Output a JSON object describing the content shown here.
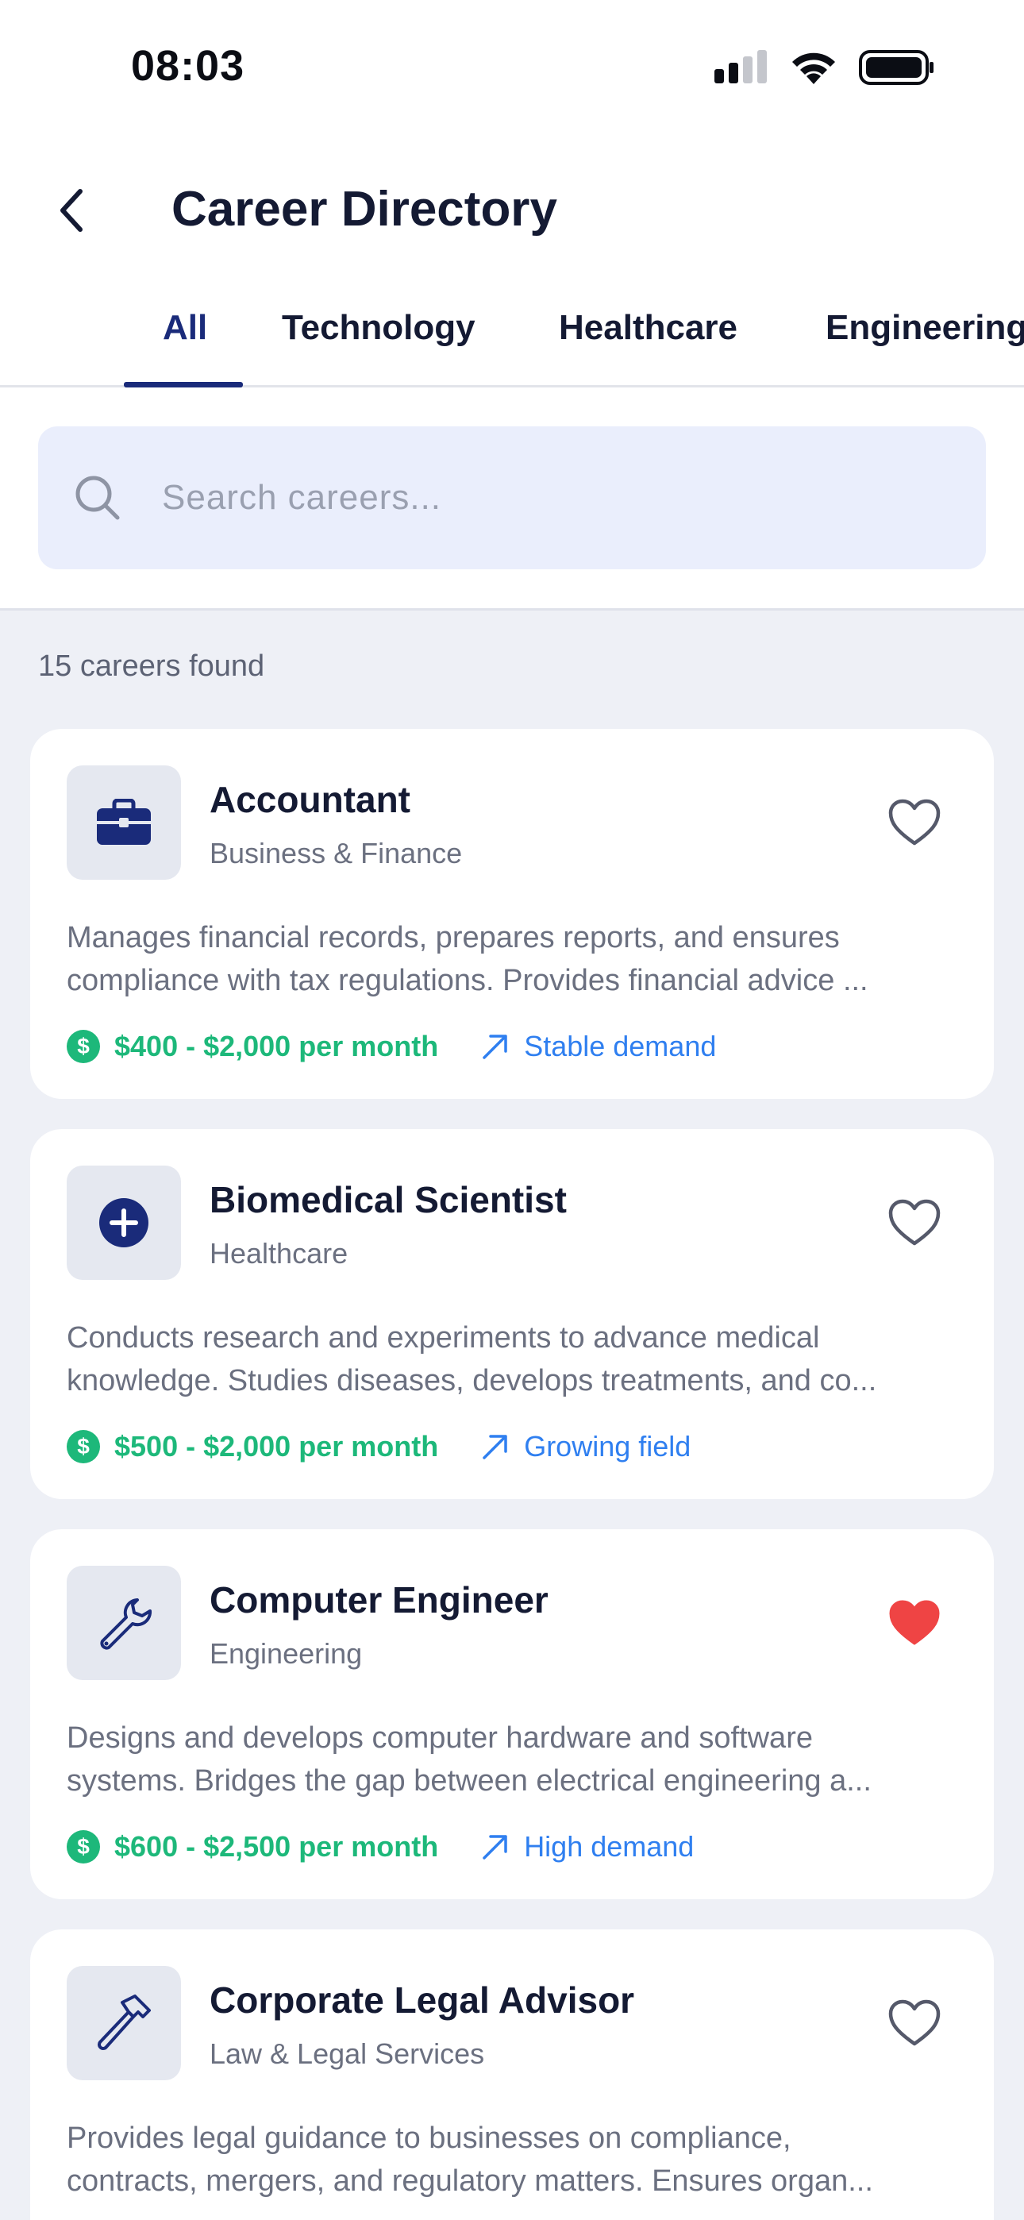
{
  "status_bar": {
    "time": "08:03"
  },
  "header": {
    "title": "Career Directory"
  },
  "tabs": [
    {
      "label": "All",
      "active": true
    },
    {
      "label": "Technology",
      "active": false
    },
    {
      "label": "Healthcare",
      "active": false
    },
    {
      "label": "Engineering",
      "active": false
    }
  ],
  "search": {
    "placeholder": "Search careers..."
  },
  "results": {
    "count_label": "15 careers found"
  },
  "colors": {
    "accent": "#1a2b7a",
    "salary": "#1db87a",
    "trend": "#2f7ff0",
    "favorite": "#ef4444"
  },
  "careers": [
    {
      "title": "Accountant",
      "category": "Business & Finance",
      "icon": "briefcase-icon",
      "desc_line1": "Manages financial records, prepares reports, and ensures",
      "desc_line2": "compliance with tax regulations. Provides financial advice ...",
      "salary": "$400 - $2,000 per month",
      "demand": "Stable demand",
      "favorite": false
    },
    {
      "title": "Biomedical Scientist",
      "category": "Healthcare",
      "icon": "plus-circle-icon",
      "desc_line1": "Conducts research and experiments to advance medical",
      "desc_line2": "knowledge. Studies diseases, develops treatments, and co...",
      "salary": "$500 - $2,000 per month",
      "demand": "Growing field",
      "favorite": false
    },
    {
      "title": "Computer Engineer",
      "category": "Engineering",
      "icon": "wrench-icon",
      "desc_line1": "Designs and develops computer hardware and software",
      "desc_line2": "systems. Bridges the gap between electrical engineering a...",
      "salary": "$600 - $2,500 per month",
      "demand": "High demand",
      "favorite": true
    },
    {
      "title": "Corporate Legal Advisor",
      "category": "Law & Legal Services",
      "icon": "hammer-icon",
      "desc_line1": "Provides legal guidance to businesses on compliance,",
      "desc_line2": "contracts, mergers, and regulatory matters. Ensures organ...",
      "salary": "",
      "demand": "",
      "favorite": false
    }
  ]
}
